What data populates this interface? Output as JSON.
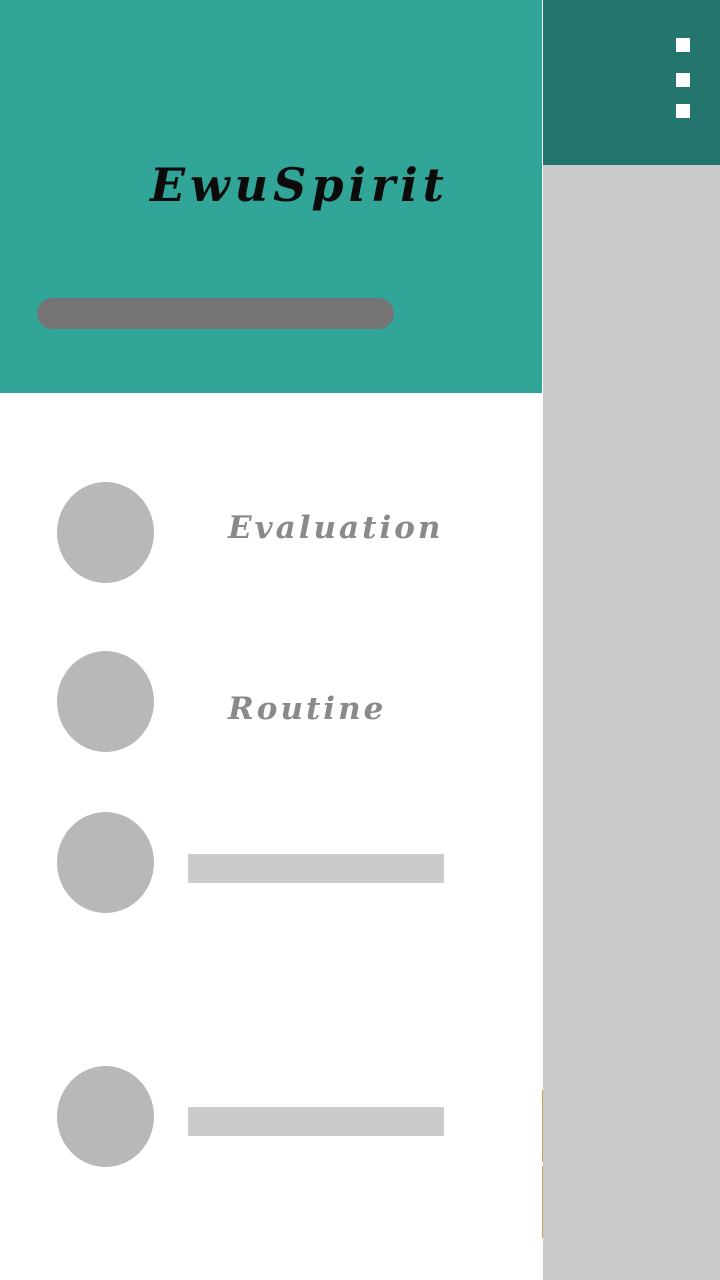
{
  "app": {
    "overflow_menu_icon": "more-vert-icon",
    "colors": {
      "toolbar": "#23756e",
      "content_dim": "#cbcbcb",
      "drawer_header": "#31a598",
      "accent_edge": "#c8a455"
    }
  },
  "drawer": {
    "title": "EwuSpirit",
    "items": [
      {
        "label": "Evaluation",
        "icon": "circle-icon"
      },
      {
        "label": "Routine",
        "icon": "circle-icon"
      },
      {
        "label": "",
        "icon": "circle-icon"
      },
      {
        "label": "",
        "icon": "circle-icon"
      }
    ]
  }
}
